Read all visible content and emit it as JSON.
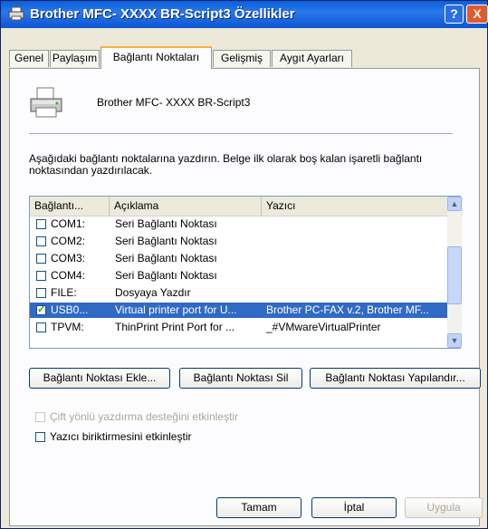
{
  "window": {
    "title": "Brother MFC- XXXX   BR-Script3 Özellikler",
    "help": "?",
    "close": "X"
  },
  "tabs": [
    "Genel",
    "Paylaşım",
    "Bağlantı Noktaları",
    "Gelişmiş",
    "Aygıt Ayarları"
  ],
  "printer_name": "Brother MFC- XXXX   BR-Script3",
  "description": "Aşağıdaki bağlantı noktalarına yazdırın. Belge ilk olarak boş kalan işaretli bağlantı noktasından yazdırılacak.",
  "ports": {
    "columns": [
      "Bağlantı...",
      "Açıklama",
      "Yazıcı"
    ],
    "rows": [
      {
        "checked": false,
        "port": "COM1:",
        "desc": "Seri Bağlantı Noktası",
        "printer": ""
      },
      {
        "checked": false,
        "port": "COM2:",
        "desc": "Seri Bağlantı Noktası",
        "printer": ""
      },
      {
        "checked": false,
        "port": "COM3:",
        "desc": "Seri Bağlantı Noktası",
        "printer": ""
      },
      {
        "checked": false,
        "port": "COM4:",
        "desc": "Seri Bağlantı Noktası",
        "printer": ""
      },
      {
        "checked": false,
        "port": "FILE:",
        "desc": "Dosyaya Yazdır",
        "printer": ""
      },
      {
        "checked": true,
        "port": "USB0...",
        "desc": "Virtual printer port for U...",
        "printer": "Brother PC-FAX v.2, Brother MF...",
        "selected": true
      },
      {
        "checked": false,
        "port": "TPVM:",
        "desc": "ThinPrint Print Port for ...",
        "printer": "_#VMwareVirtualPrinter"
      }
    ]
  },
  "buttons": {
    "add_port": "Bağlantı Noktası Ekle...",
    "delete_port": "Bağlantı Noktası Sil",
    "configure_port": "Bağlantı Noktası Yapılandır...",
    "ok": "Tamam",
    "cancel": "İptal",
    "apply": "Uygula"
  },
  "options": {
    "bidirectional": "Çift yönlü yazdırma desteğini etkinleştir",
    "pooling": "Yazıcı biriktirmesini etkinleştir"
  }
}
